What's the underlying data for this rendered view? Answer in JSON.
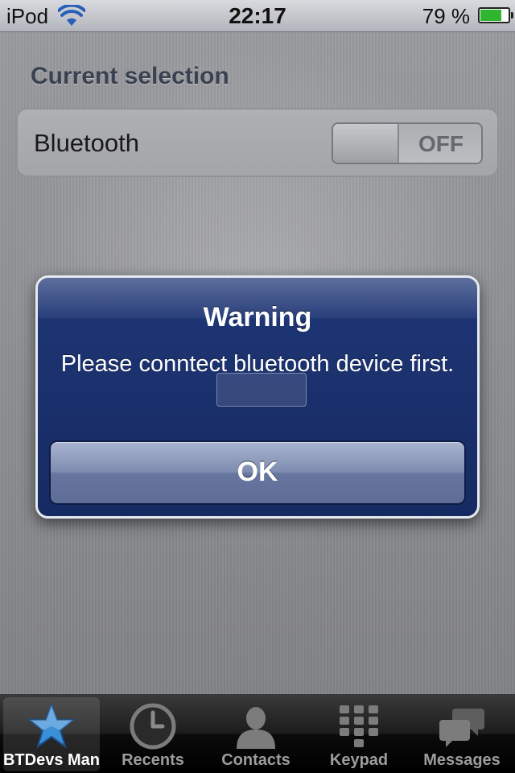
{
  "status_bar": {
    "carrier": "iPod",
    "time": "22:17",
    "battery_text": "79 %",
    "battery_level": 0.79,
    "wifi_icon": "wifi-icon",
    "battery_icon": "battery-icon"
  },
  "section": {
    "title": "Current selection"
  },
  "bluetooth_row": {
    "label": "Bluetooth",
    "switch_state": "OFF"
  },
  "alert": {
    "title": "Warning",
    "message": "Please conntect bluetooth device first.",
    "ok_label": "OK"
  },
  "tabs": [
    {
      "label": "BTDevs Man",
      "icon": "star-icon",
      "selected": true
    },
    {
      "label": "Recents",
      "icon": "clock-icon",
      "selected": false
    },
    {
      "label": "Contacts",
      "icon": "person-icon",
      "selected": false
    },
    {
      "label": "Keypad",
      "icon": "keypad-icon",
      "selected": false
    },
    {
      "label": "Messages",
      "icon": "chat-bubbles-icon",
      "selected": false
    }
  ],
  "colors": {
    "alert_blue": "#1f3777",
    "selected_star": "#3b8fd6",
    "battery_green": "#2fb52f"
  }
}
